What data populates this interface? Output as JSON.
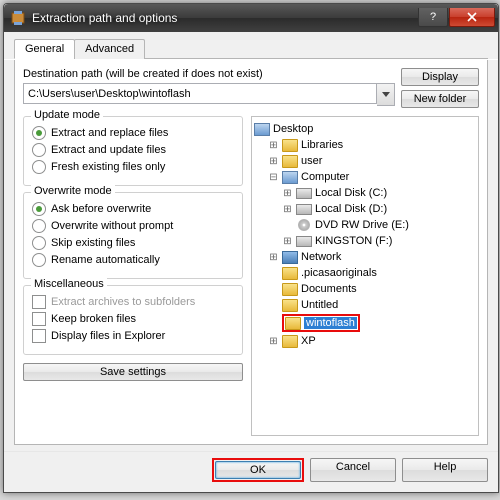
{
  "titlebar": {
    "title": "Extraction path and options"
  },
  "tabs": {
    "general": "General",
    "advanced": "Advanced"
  },
  "dest": {
    "label": "Destination path (will be created if does not exist)",
    "value": "C:\\Users\\user\\Desktop\\wintoflash"
  },
  "buttons": {
    "display": "Display",
    "newfolder": "New folder",
    "save": "Save settings",
    "ok": "OK",
    "cancel": "Cancel",
    "help": "Help"
  },
  "groups": {
    "update": {
      "title": "Update mode",
      "opt1": "Extract and replace files",
      "opt2": "Extract and update files",
      "opt3": "Fresh existing files only"
    },
    "overwrite": {
      "title": "Overwrite mode",
      "opt1": "Ask before overwrite",
      "opt2": "Overwrite without prompt",
      "opt3": "Skip existing files",
      "opt4": "Rename automatically"
    },
    "misc": {
      "title": "Miscellaneous",
      "chk1": "Extract archives to subfolders",
      "chk2": "Keep broken files",
      "chk3": "Display files in Explorer"
    }
  },
  "tree": {
    "desktop": "Desktop",
    "libraries": "Libraries",
    "user": "user",
    "computer": "Computer",
    "localc": "Local Disk (C:)",
    "locald": "Local Disk (D:)",
    "dvd": "DVD RW Drive (E:)",
    "kingston": "KINGSTON (F:)",
    "network": "Network",
    "picasa": ".picasaoriginals",
    "documents": "Documents",
    "untitled": "Untitled",
    "wintoflash": "wintoflash",
    "xp": "XP"
  }
}
